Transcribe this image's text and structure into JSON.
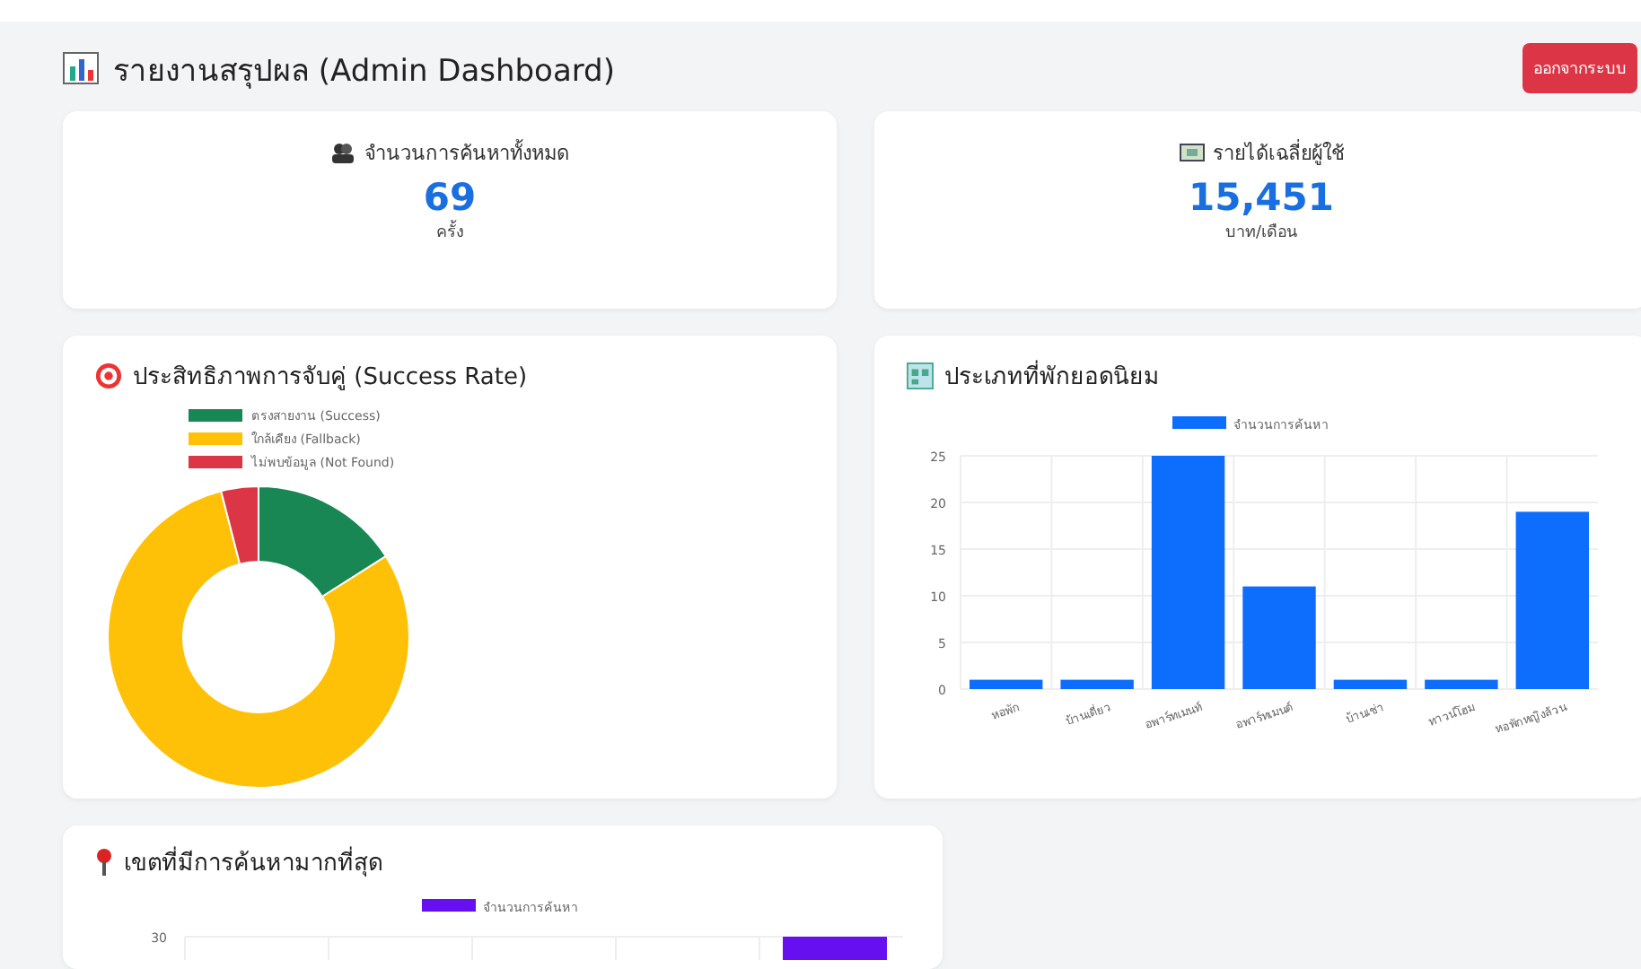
{
  "header": {
    "title": "รายงานสรุปผล (Admin Dashboard)",
    "logout_button": "ออกจากระบบ"
  },
  "stats": [
    {
      "label": "จำนวนการค้นหาทั้งหมด",
      "value": "69",
      "unit": "ครั้ง",
      "kind": "people"
    },
    {
      "label": "รายได้เฉลี่ยผู้ใช้",
      "value": "15,451",
      "unit": "บาท/เดือน",
      "kind": "money"
    }
  ],
  "match_card": {
    "title": "ประสิทธิภาพการจับคู่ (Success Rate)",
    "legend": [
      {
        "label": "ตรงสายงาน (Success)",
        "color": "#198754"
      },
      {
        "label": "ใกล้เคียง (Fallback)",
        "color": "#ffc107"
      },
      {
        "label": "ไม่พบข้อมูล (Not Found)",
        "color": "#dc3545"
      }
    ]
  },
  "type_card": {
    "title": "ประเภทที่พักยอดนิยม",
    "chart_data": {
      "type": "bar",
      "categories": [
        "หอพัก",
        "บ้านเดี่ยว",
        "อพาร์ทเมนท์",
        "อพาร์ทเมนต์",
        "บ้านเช่า",
        "ทาวน์โฮม",
        "หอพักหญิงล้วน"
      ],
      "series": [
        {
          "name": "จำนวนการค้นหา",
          "color": "#0d6efd",
          "values": [
            1,
            1,
            25,
            11,
            1,
            1,
            19
          ]
        }
      ],
      "ylim": [
        0,
        25
      ],
      "grid": true,
      "yticks": [
        0,
        5,
        10,
        15,
        20,
        25
      ]
    }
  },
  "zone_card": {
    "title": "เขตที่มีการค้นหามากที่สุด",
    "legend": "จำนวนการค้นหา",
    "tick": "30"
  }
}
